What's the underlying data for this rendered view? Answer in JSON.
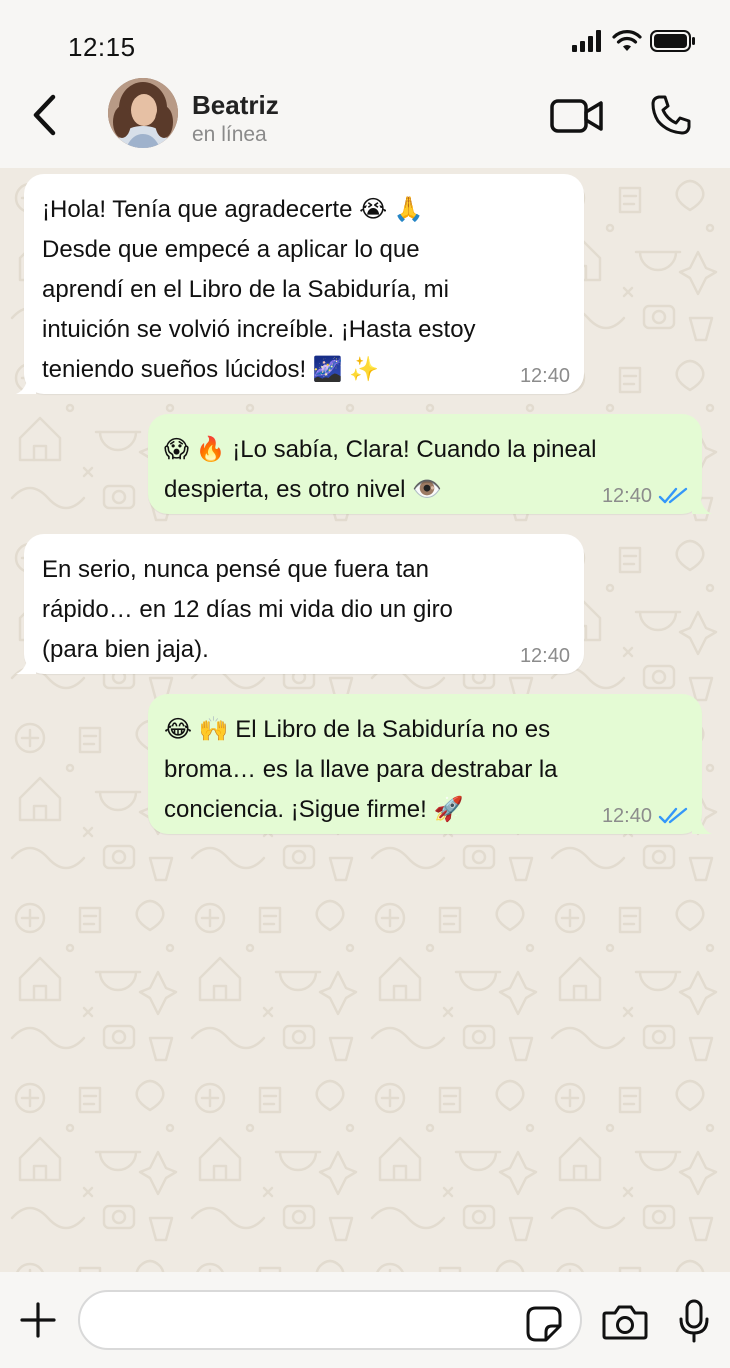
{
  "status_bar": {
    "time": "12:15"
  },
  "header": {
    "back_icon": "chevron-left-icon",
    "contact_name": "Beatriz",
    "contact_status": "en línea",
    "video_icon": "video-camera-icon",
    "call_icon": "phone-icon"
  },
  "messages": [
    {
      "direction": "incoming",
      "text": "¡Hola! Tenía que agradecerte 😭 🙏\nDesde que empecé a aplicar lo que\naprendí en el Libro de la Sabiduría, mi\nintuición se volvió increíble. ¡Hasta estoy\nteniendo sueños lúcidos! 🌌 ✨",
      "time": "12:40"
    },
    {
      "direction": "outgoing",
      "text": "😱 🔥  ¡Lo sabía, Clara! Cuando la pineal\ndespierta, es otro nivel 👁️",
      "time": "12:40",
      "status": "read"
    },
    {
      "direction": "incoming",
      "text": "En serio, nunca pensé que fuera tan\nrápido… en 12 días mi vida dio un giro\n(para bien jaja).",
      "time": "12:40"
    },
    {
      "direction": "outgoing",
      "text": "😂 🙌  El Libro de la Sabiduría no es\nbroma… es la llave para destrabar la\nconciencia. ¡Sigue firme! 🚀",
      "time": "12:40",
      "status": "read"
    }
  ],
  "input_bar": {
    "placeholder": "",
    "plus_icon": "plus-icon",
    "sticker_icon": "sticker-icon",
    "camera_icon": "camera-icon",
    "mic_icon": "microphone-icon"
  },
  "colors": {
    "incoming_bubble": "#ffffff",
    "outgoing_bubble": "#e4fbd4",
    "read_ticks": "#3497f9",
    "chat_background": "#efeae2"
  }
}
